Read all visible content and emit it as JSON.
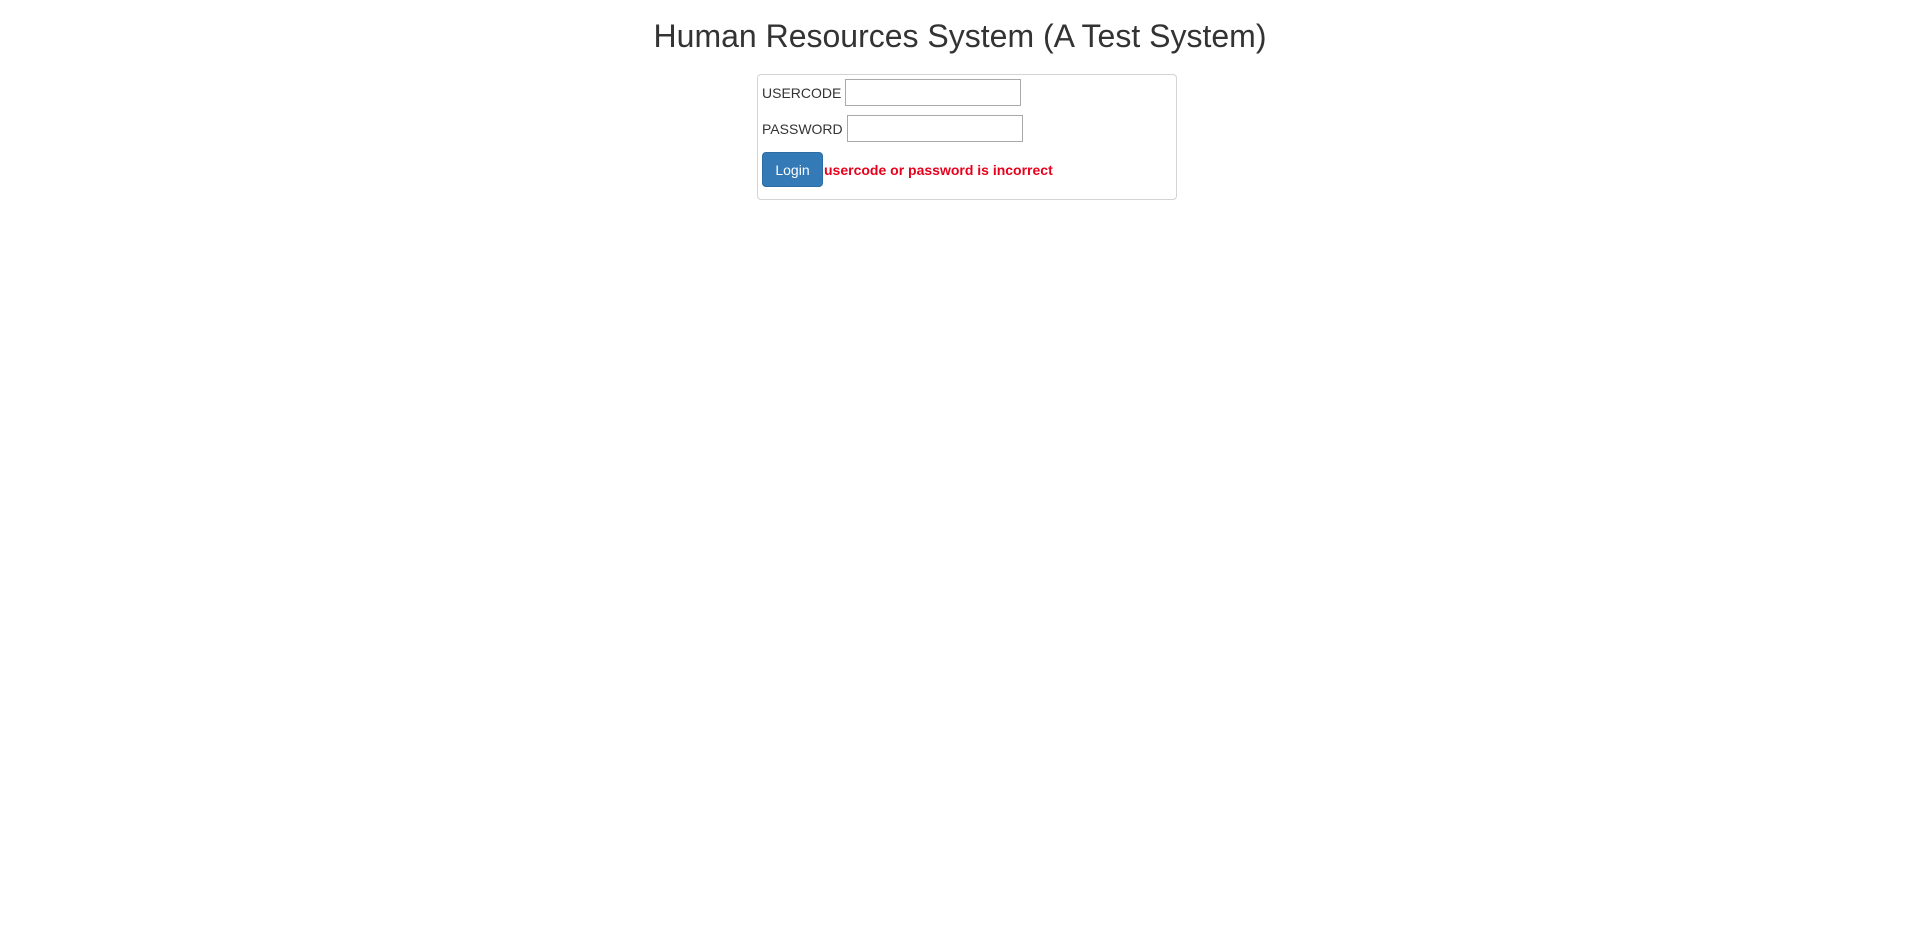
{
  "header": {
    "title": "Human Resources System (A Test System)"
  },
  "login_form": {
    "usercode": {
      "label": "USERCODE",
      "value": "",
      "placeholder": ""
    },
    "password": {
      "label": "PASSWORD",
      "value": "",
      "placeholder": ""
    },
    "login_button_label": "Login",
    "error_message": "usercode or password is incorrect"
  },
  "colors": {
    "primary_button": "#337ab7",
    "error_text": "#e8001c",
    "panel_border": "#d4d4d4",
    "text": "#333333"
  }
}
